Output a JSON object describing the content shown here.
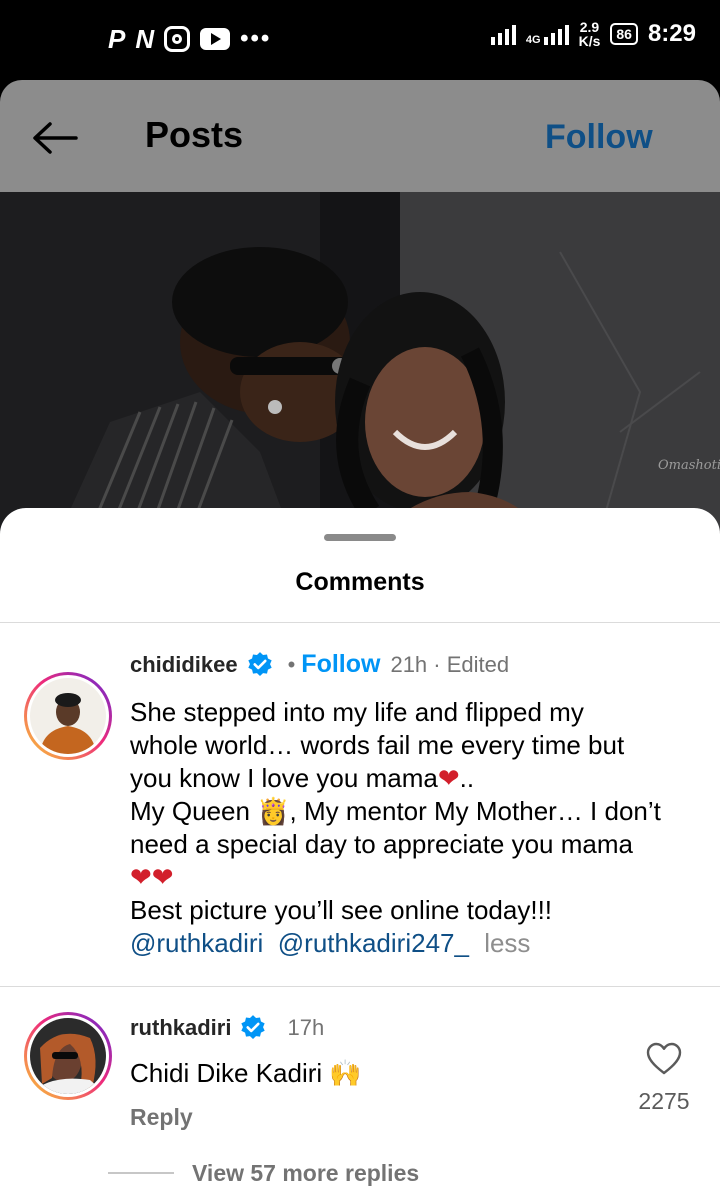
{
  "status_bar": {
    "glyph_p": "P",
    "glyph_n": "N",
    "overflow": "•••",
    "network": "4G",
    "speed_value": "2.9",
    "speed_unit": "K/s",
    "battery": "86",
    "time": "8:29",
    "icons": [
      "pinterest-icon",
      "app-n-icon",
      "instagram-icon",
      "youtube-icon",
      "signal-icon",
      "battery-icon"
    ]
  },
  "header": {
    "title": "Posts",
    "follow_label": "Follow",
    "follow_color": "#0f4f86"
  },
  "photo": {
    "watermark": "Omashotit"
  },
  "comments": {
    "title": "Comments",
    "items": [
      {
        "username": "chididikee",
        "follow_label": "Follow",
        "separator": "•",
        "meta": "21h · Edited",
        "lines": [
          "She stepped into my life and flipped my",
          "whole world… words fail me every time but",
          "you know I love you mama",
          "..",
          "My Queen ",
          ", My mentor My Mother… I don’t",
          "need a special day to appreciate you mama",
          "Best picture you’ll see online today!!!"
        ],
        "mentions": [
          "@ruthkadiri",
          "@ruthkadiri247_"
        ],
        "less_label": "less",
        "emoji_heart": "❤",
        "emoji_queen": "👸"
      },
      {
        "username": "ruthkadiri",
        "meta": "17h",
        "text": "Chidi Dike Kadiri ",
        "emoji_hands": "🙌",
        "reply_label": "Reply",
        "like_count": "2275",
        "view_more": "View 57 more replies"
      }
    ]
  },
  "colors": {
    "verified": "#0095f6",
    "follow_link": "#0095f6",
    "heart": "#d21f2b"
  }
}
